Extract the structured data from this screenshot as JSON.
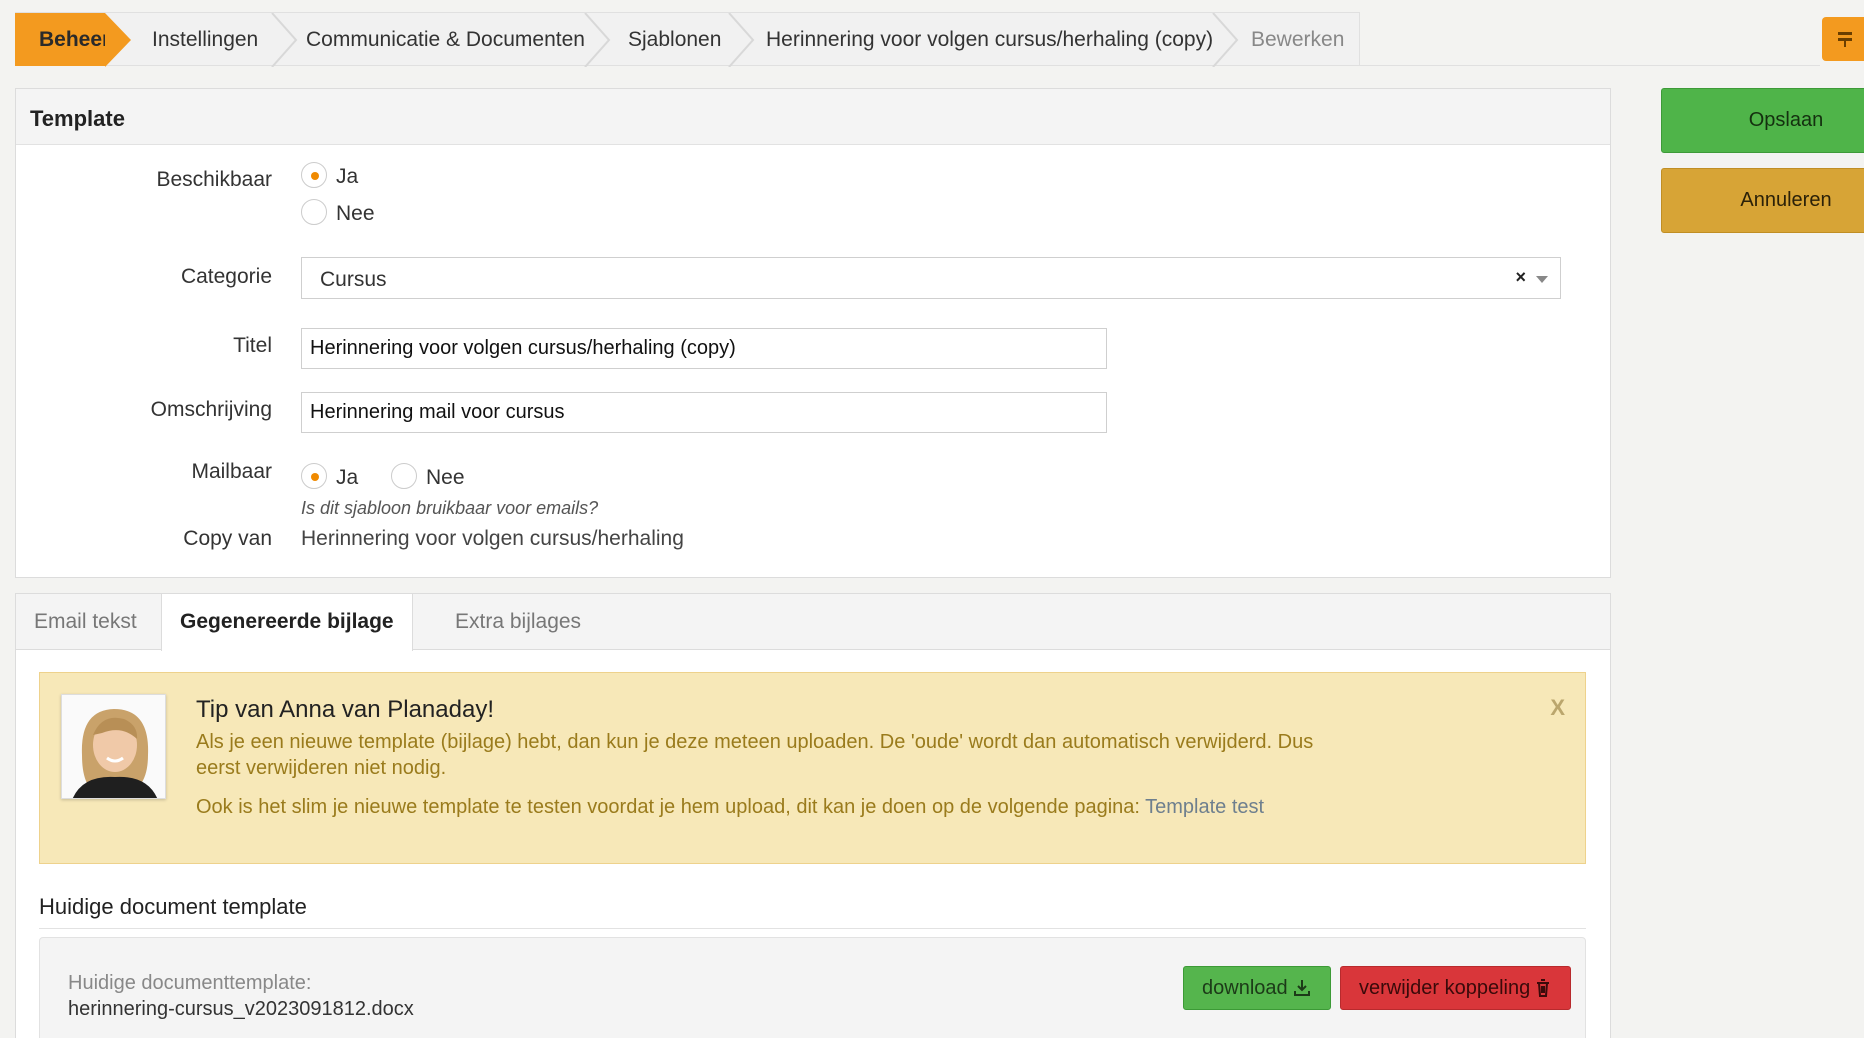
{
  "breadcrumb": {
    "items": [
      "Beheer",
      "Instellingen",
      "Communicatie & Documenten",
      "Sjablonen",
      "Herinnering voor volgen cursus/herhaling (copy)",
      "Bewerken"
    ]
  },
  "actions": {
    "save": "Opslaan",
    "cancel": "Annuleren"
  },
  "form": {
    "header": "Template",
    "beschikbaar": {
      "label": "Beschikbaar",
      "options": [
        "Ja",
        "Nee"
      ],
      "selected": "Ja"
    },
    "categorie": {
      "label": "Categorie",
      "value": "Cursus",
      "clear": "×"
    },
    "titel": {
      "label": "Titel",
      "value": "Herinnering voor volgen cursus/herhaling (copy)"
    },
    "omschrijving": {
      "label": "Omschrijving",
      "value": "Herinnering mail voor cursus"
    },
    "mailbaar": {
      "label": "Mailbaar",
      "options": [
        "Ja",
        "Nee"
      ],
      "selected": "Ja",
      "hint": "Is dit sjabloon bruikbaar voor emails?"
    },
    "copy_van": {
      "label": "Copy van",
      "value": "Herinnering voor volgen cursus/herhaling"
    }
  },
  "tabs": [
    "Email tekst",
    "Gegenereerde bijlage",
    "Extra bijlages"
  ],
  "active_tab": "Gegenereerde bijlage",
  "tip": {
    "title": "Tip van Anna van Planaday!",
    "line1": "Als je een nieuwe template (bijlage) hebt, dan kun je deze meteen uploaden. De 'oude' wordt dan automatisch verwijderd. Dus eerst verwijderen niet nodig.",
    "line2": "Ook is het slim je nieuwe template te testen voordat je hem upload, dit kan je doen op de volgende pagina: ",
    "link": "Template test",
    "close": "X"
  },
  "document": {
    "section_title": "Huidige document template",
    "label": "Huidige documenttemplate:",
    "filename": "herinnering-cursus_v2023091812.docx",
    "download": "download",
    "remove": "verwijder koppeling"
  },
  "colors": {
    "accent": "#f39a1f",
    "save": "#4fb449",
    "cancel": "#d7a436",
    "tip_bg": "#f7e8b8"
  }
}
